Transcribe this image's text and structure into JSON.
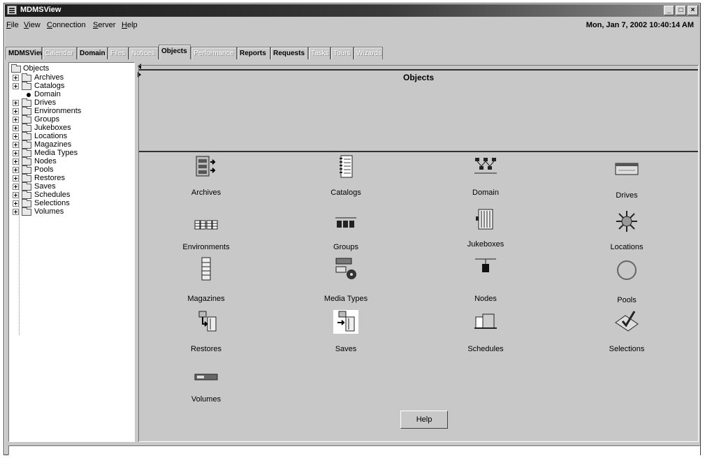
{
  "window": {
    "title": "MDMSView"
  },
  "menu": [
    "File",
    "View",
    "Connection",
    "Server",
    "Help"
  ],
  "datetime": "Mon, Jan 7, 2002 10:40:14 AM",
  "tabs": [
    {
      "label": "MDMSView",
      "state": "enabled"
    },
    {
      "label": "Calendar",
      "state": "disabled"
    },
    {
      "label": "Domain",
      "state": "enabled"
    },
    {
      "label": "Files",
      "state": "disabled"
    },
    {
      "label": "Notices",
      "state": "disabled"
    },
    {
      "label": "Objects",
      "state": "active"
    },
    {
      "label": "Performance",
      "state": "disabled"
    },
    {
      "label": "Reports",
      "state": "enabled"
    },
    {
      "label": "Requests",
      "state": "enabled"
    },
    {
      "label": "Tasks",
      "state": "disabled"
    },
    {
      "label": "Tours",
      "state": "disabled"
    },
    {
      "label": "Wizards",
      "state": "disabled"
    }
  ],
  "tree": {
    "root": "Objects",
    "items": [
      "Archives",
      "Catalogs",
      "Domain",
      "Drives",
      "Environments",
      "Groups",
      "Jukeboxes",
      "Locations",
      "Magazines",
      "Media Types",
      "Nodes",
      "Pools",
      "Restores",
      "Saves",
      "Schedules",
      "Selections",
      "Volumes"
    ]
  },
  "panel": {
    "heading": "Objects",
    "objects": [
      {
        "label": "Archives",
        "icon": "archives-icon"
      },
      {
        "label": "Catalogs",
        "icon": "catalogs-icon"
      },
      {
        "label": "Domain",
        "icon": "domain-icon"
      },
      {
        "label": "Drives",
        "icon": "drives-icon"
      },
      {
        "label": "Environments",
        "icon": "environments-icon"
      },
      {
        "label": "Groups",
        "icon": "groups-icon"
      },
      {
        "label": "Jukeboxes",
        "icon": "jukeboxes-icon"
      },
      {
        "label": "Locations",
        "icon": "locations-icon"
      },
      {
        "label": "Magazines",
        "icon": "magazines-icon"
      },
      {
        "label": "Media Types",
        "icon": "media-types-icon"
      },
      {
        "label": "Nodes",
        "icon": "nodes-icon"
      },
      {
        "label": "Pools",
        "icon": "pools-icon"
      },
      {
        "label": "Restores",
        "icon": "restores-icon"
      },
      {
        "label": "Saves",
        "icon": "saves-icon"
      },
      {
        "label": "Schedules",
        "icon": "schedules-icon"
      },
      {
        "label": "Selections",
        "icon": "selections-icon"
      },
      {
        "label": "Volumes",
        "icon": "volumes-icon"
      }
    ],
    "help_label": "Help"
  }
}
